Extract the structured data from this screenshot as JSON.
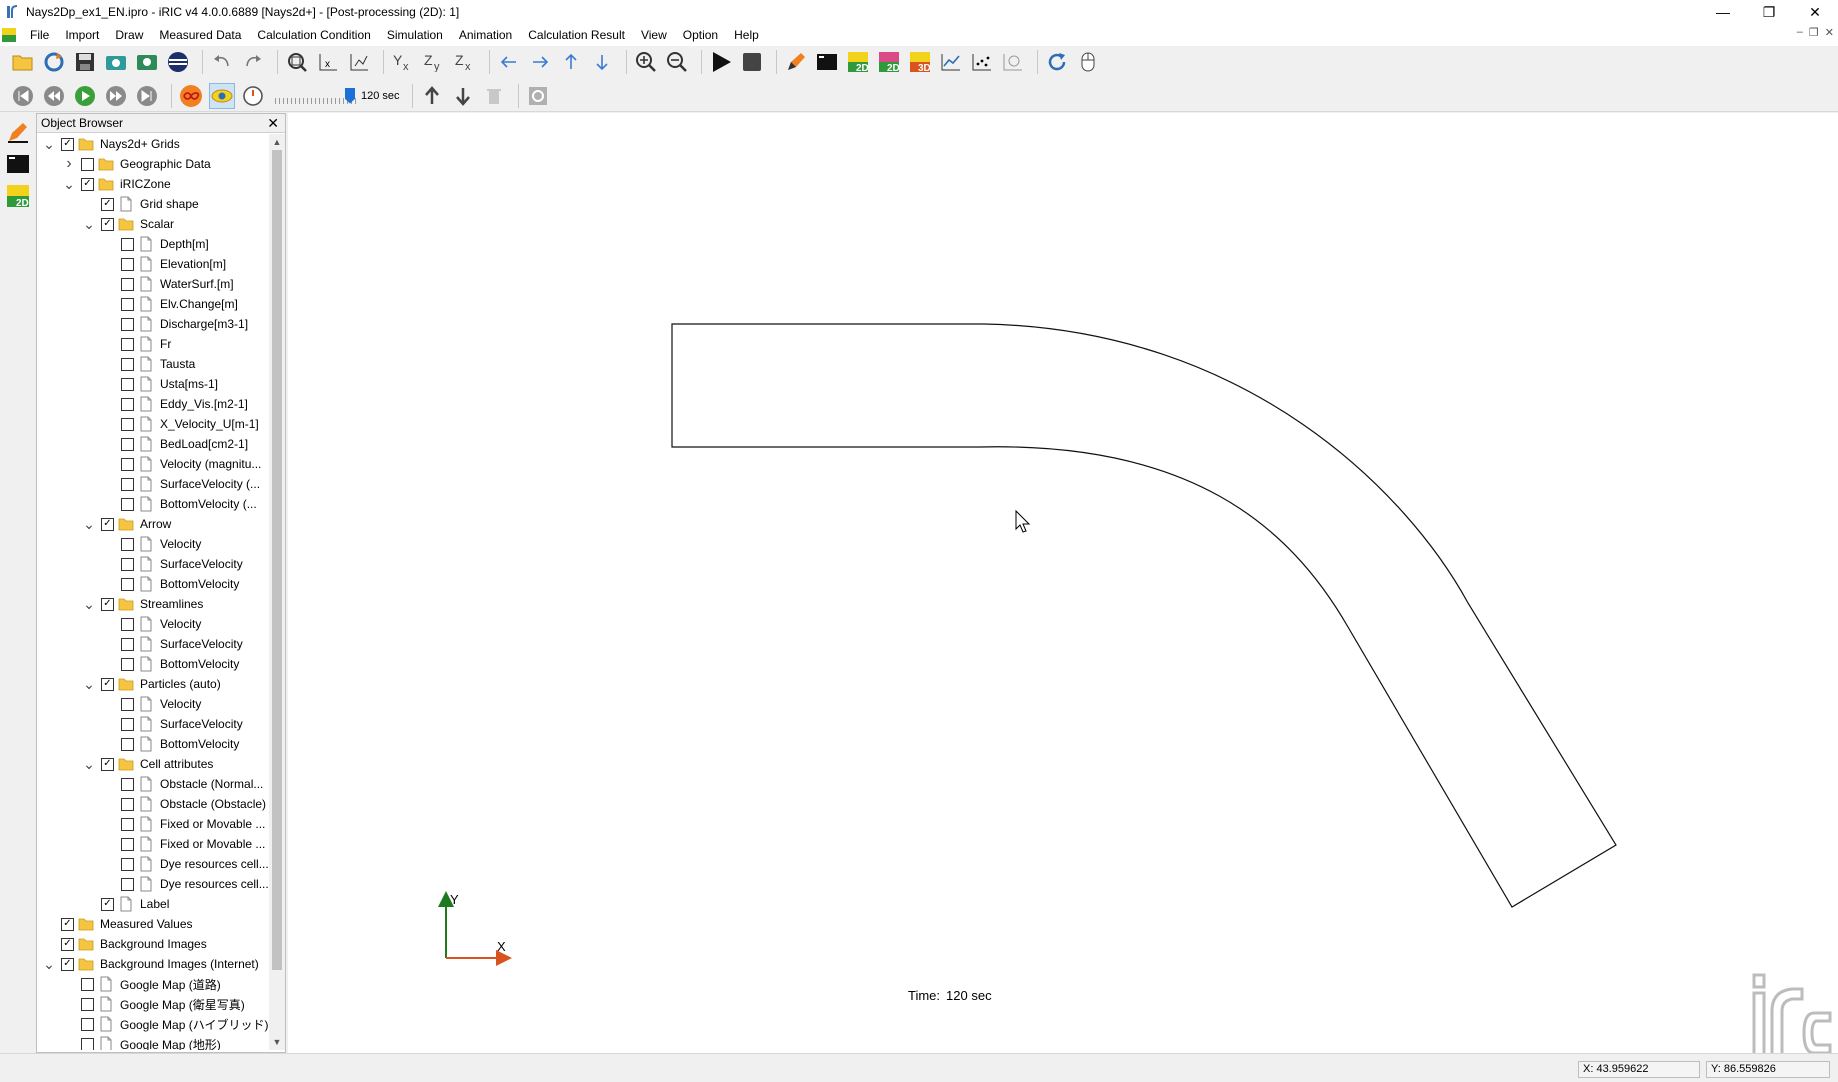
{
  "window": {
    "title": "Nays2Dp_ex1_EN.ipro - iRIC v4 4.0.0.6889 [Nays2d+] - [Post-processing (2D): 1]"
  },
  "menu": [
    "File",
    "Import",
    "Draw",
    "Measured Data",
    "Calculation Condition",
    "Simulation",
    "Animation",
    "Calculation Result",
    "View",
    "Option",
    "Help"
  ],
  "animation": {
    "speed_label": "120 sec"
  },
  "object_browser": {
    "title": "Object Browser",
    "items": [
      {
        "label": "Nays2d+ Grids",
        "level": 0,
        "expander": "open",
        "checked": true,
        "icon": "folder-icon"
      },
      {
        "label": "Geographic Data",
        "level": 1,
        "expander": "closed",
        "checked": false,
        "icon": "folder-icon"
      },
      {
        "label": "iRICZone",
        "level": 1,
        "expander": "open",
        "checked": true,
        "icon": "folder-icon"
      },
      {
        "label": "Grid shape",
        "level": 2,
        "expander": "",
        "checked": true,
        "icon": "file-icon"
      },
      {
        "label": "Scalar",
        "level": 2,
        "expander": "open",
        "checked": true,
        "icon": "folder-icon"
      },
      {
        "label": "Depth[m]",
        "level": 3,
        "expander": "",
        "checked": false,
        "icon": "file-icon"
      },
      {
        "label": "Elevation[m]",
        "level": 3,
        "expander": "",
        "checked": false,
        "icon": "file-icon"
      },
      {
        "label": "WaterSurf.[m]",
        "level": 3,
        "expander": "",
        "checked": false,
        "icon": "file-icon"
      },
      {
        "label": "Elv.Change[m]",
        "level": 3,
        "expander": "",
        "checked": false,
        "icon": "file-icon"
      },
      {
        "label": "Discharge[m3-1]",
        "level": 3,
        "expander": "",
        "checked": false,
        "icon": "file-icon"
      },
      {
        "label": "Fr",
        "level": 3,
        "expander": "",
        "checked": false,
        "icon": "file-icon"
      },
      {
        "label": "Tausta",
        "level": 3,
        "expander": "",
        "checked": false,
        "icon": "file-icon"
      },
      {
        "label": "Usta[ms-1]",
        "level": 3,
        "expander": "",
        "checked": false,
        "icon": "file-icon"
      },
      {
        "label": "Eddy_Vis.[m2-1]",
        "level": 3,
        "expander": "",
        "checked": false,
        "icon": "file-icon"
      },
      {
        "label": "X_Velocity_U[m-1]",
        "level": 3,
        "expander": "",
        "checked": false,
        "icon": "file-icon"
      },
      {
        "label": "BedLoad[cm2-1]",
        "level": 3,
        "expander": "",
        "checked": false,
        "icon": "file-icon"
      },
      {
        "label": "Velocity (magnitu...",
        "level": 3,
        "expander": "",
        "checked": false,
        "icon": "file-icon"
      },
      {
        "label": "SurfaceVelocity (...",
        "level": 3,
        "expander": "",
        "checked": false,
        "icon": "file-icon"
      },
      {
        "label": "BottomVelocity (...",
        "level": 3,
        "expander": "",
        "checked": false,
        "icon": "file-icon"
      },
      {
        "label": "Arrow",
        "level": 2,
        "expander": "open",
        "checked": true,
        "icon": "folder-icon"
      },
      {
        "label": "Velocity",
        "level": 3,
        "expander": "",
        "checked": false,
        "icon": "file-icon"
      },
      {
        "label": "SurfaceVelocity",
        "level": 3,
        "expander": "",
        "checked": false,
        "icon": "file-icon"
      },
      {
        "label": "BottomVelocity",
        "level": 3,
        "expander": "",
        "checked": false,
        "icon": "file-icon"
      },
      {
        "label": "Streamlines",
        "level": 2,
        "expander": "open",
        "checked": true,
        "icon": "folder-icon"
      },
      {
        "label": "Velocity",
        "level": 3,
        "expander": "",
        "checked": false,
        "icon": "file-icon"
      },
      {
        "label": "SurfaceVelocity",
        "level": 3,
        "expander": "",
        "checked": false,
        "icon": "file-icon"
      },
      {
        "label": "BottomVelocity",
        "level": 3,
        "expander": "",
        "checked": false,
        "icon": "file-icon"
      },
      {
        "label": "Particles (auto)",
        "level": 2,
        "expander": "open",
        "checked": true,
        "icon": "folder-icon"
      },
      {
        "label": "Velocity",
        "level": 3,
        "expander": "",
        "checked": false,
        "icon": "file-icon"
      },
      {
        "label": "SurfaceVelocity",
        "level": 3,
        "expander": "",
        "checked": false,
        "icon": "file-icon"
      },
      {
        "label": "BottomVelocity",
        "level": 3,
        "expander": "",
        "checked": false,
        "icon": "file-icon"
      },
      {
        "label": "Cell attributes",
        "level": 2,
        "expander": "open",
        "checked": true,
        "icon": "folder-icon"
      },
      {
        "label": "Obstacle (Normal...",
        "level": 3,
        "expander": "",
        "checked": false,
        "icon": "file-icon"
      },
      {
        "label": "Obstacle (Obstacle)",
        "level": 3,
        "expander": "",
        "checked": false,
        "icon": "file-icon"
      },
      {
        "label": "Fixed or Movable ...",
        "level": 3,
        "expander": "",
        "checked": false,
        "icon": "file-icon"
      },
      {
        "label": "Fixed or Movable ...",
        "level": 3,
        "expander": "",
        "checked": false,
        "icon": "file-icon"
      },
      {
        "label": "Dye resources cell...",
        "level": 3,
        "expander": "",
        "checked": false,
        "icon": "file-icon"
      },
      {
        "label": "Dye resources cell...",
        "level": 3,
        "expander": "",
        "checked": false,
        "icon": "file-icon"
      },
      {
        "label": "Label",
        "level": 2,
        "expander": "",
        "checked": true,
        "icon": "file-icon"
      },
      {
        "label": "Measured Values",
        "level": 0,
        "expander": "",
        "checked": true,
        "icon": "folder-icon"
      },
      {
        "label": "Background Images",
        "level": 0,
        "expander": "",
        "checked": true,
        "icon": "folder-icon"
      },
      {
        "label": "Background Images (Internet)",
        "level": 0,
        "expander": "open",
        "checked": true,
        "icon": "folder-icon"
      },
      {
        "label": "Google Map (道路)",
        "level": 1,
        "expander": "",
        "checked": false,
        "icon": "file-icon"
      },
      {
        "label": "Google Map (衛星写真)",
        "level": 1,
        "expander": "",
        "checked": false,
        "icon": "file-icon"
      },
      {
        "label": "Google Map (ハイブリッド)",
        "level": 1,
        "expander": "",
        "checked": false,
        "icon": "file-icon"
      },
      {
        "label": "Google Map (地形)",
        "level": 1,
        "expander": "",
        "checked": false,
        "icon": "file-icon"
      }
    ]
  },
  "canvas": {
    "axis_y_label": "Y",
    "axis_x_label": "X",
    "time_prefix": "Time:",
    "time_value": "120 sec"
  },
  "statusbar": {
    "x_coord": "X: 43.959622",
    "y_coord": "Y: 86.559826"
  },
  "colors": {
    "folder": "#f5c542",
    "axis_y": "#1e7a1e",
    "axis_x": "#d9531e",
    "play_green": "#3aa03a",
    "infinity_orange": "#f08020"
  }
}
